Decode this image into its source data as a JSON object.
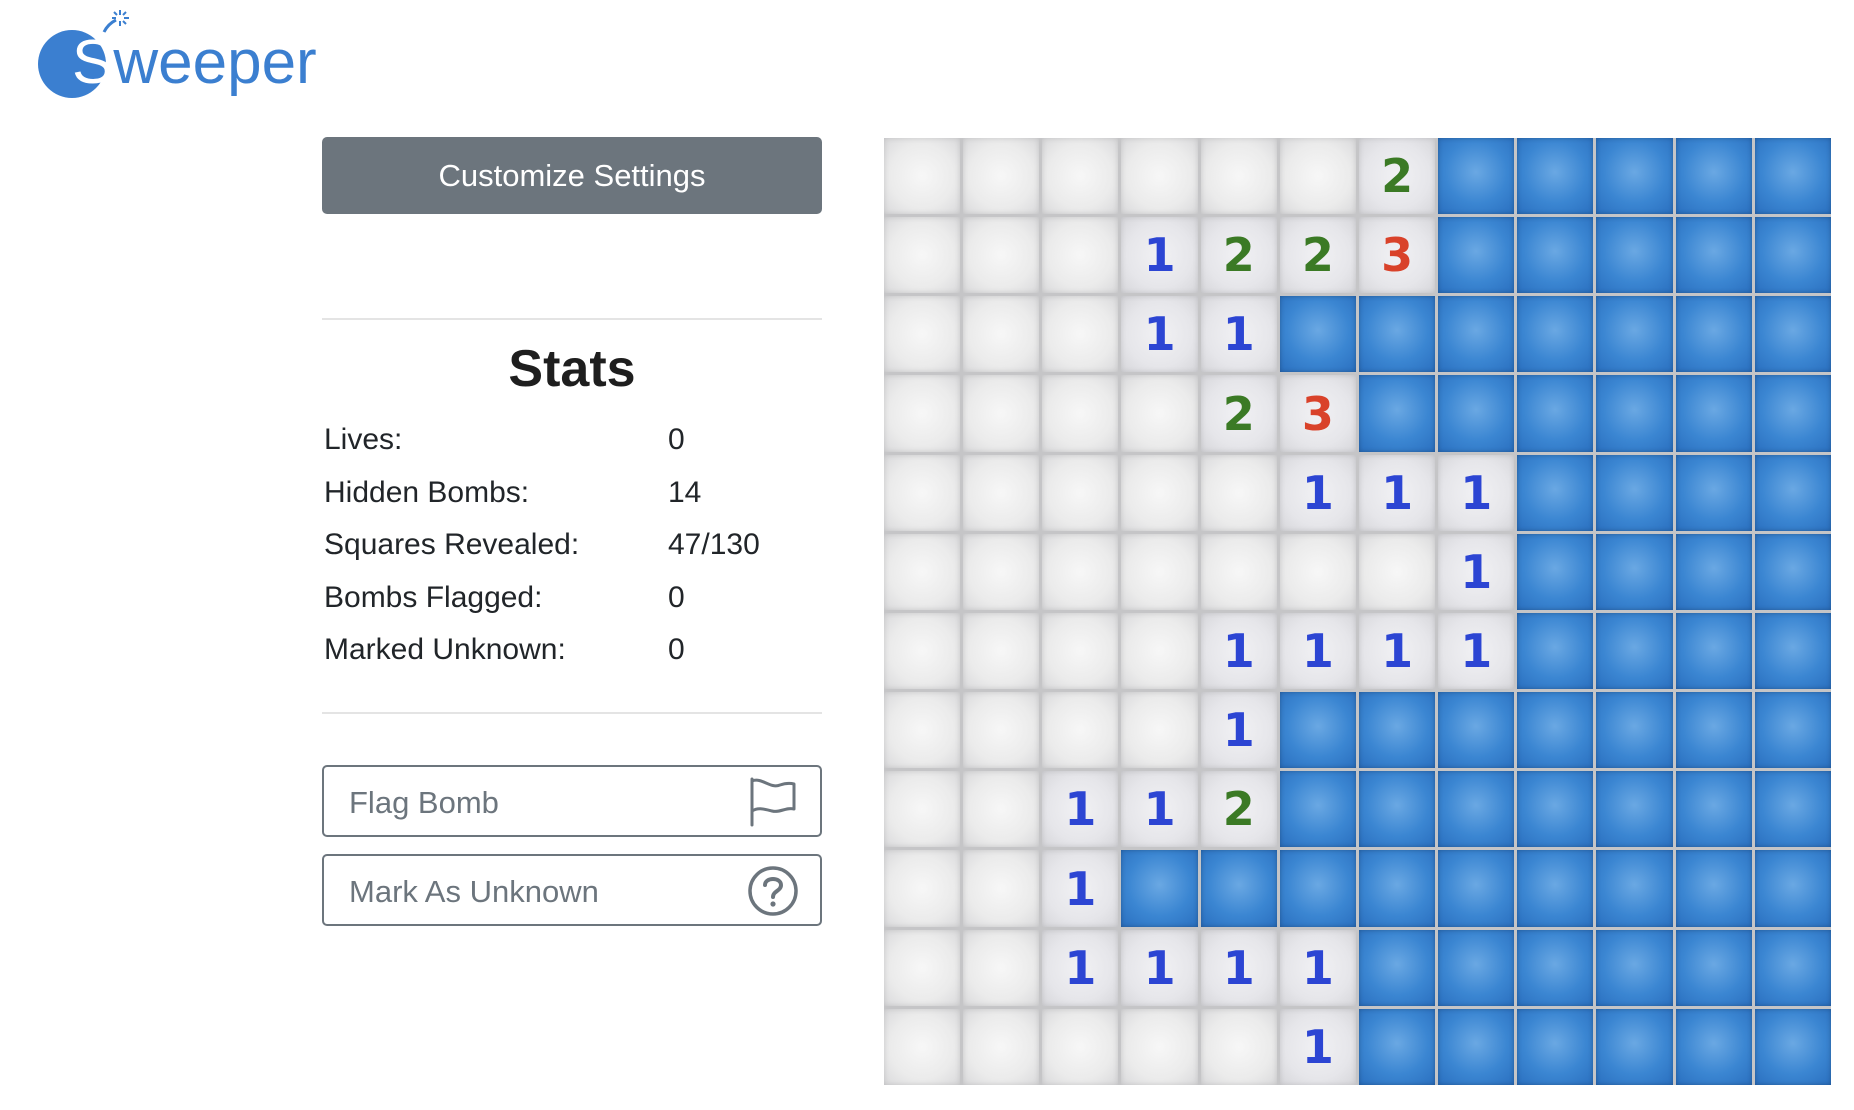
{
  "logo": {
    "text": "Sweeper",
    "accent": "#3b7fd0"
  },
  "controls": {
    "customize_label": "Customize Settings",
    "flag_label": "Flag Bomb",
    "flag_icon": "flag-icon",
    "unknown_label": "Mark As Unknown",
    "unknown_icon": "question-circle-icon"
  },
  "stats": {
    "title": "Stats",
    "rows": [
      {
        "label": "Lives:",
        "value": "0"
      },
      {
        "label": "Hidden Bombs:",
        "value": "14"
      },
      {
        "label": "Squares Revealed:",
        "value": "47/130"
      },
      {
        "label": "Bombs Flagged:",
        "value": "0"
      },
      {
        "label": "Marked Unknown:",
        "value": "0"
      }
    ]
  },
  "board": {
    "rows": 12,
    "cols": 12,
    "colors": {
      "1": "#2c45d3",
      "2": "#3b7a25",
      "3": "#d9422a",
      "hidden": "#3b86d2",
      "revealed": "#ebebeb"
    },
    "grid": [
      [
        "",
        "",
        "",
        "",
        "",
        "",
        "2",
        "H",
        "H",
        "H",
        "H",
        "H"
      ],
      [
        "",
        "",
        "",
        "1",
        "2",
        "2",
        "3",
        "H",
        "H",
        "H",
        "H",
        "H"
      ],
      [
        "",
        "",
        "",
        "1",
        "1",
        "H",
        "H",
        "H",
        "H",
        "H",
        "H",
        "H"
      ],
      [
        "",
        "",
        "",
        "",
        "2",
        "3",
        "H",
        "H",
        "H",
        "H",
        "H",
        "H"
      ],
      [
        "",
        "",
        "",
        "",
        "",
        "1",
        "1",
        "1",
        "H",
        "H",
        "H",
        "H"
      ],
      [
        "",
        "",
        "",
        "",
        "",
        "",
        "",
        "1",
        "H",
        "H",
        "H",
        "H"
      ],
      [
        "",
        "",
        "",
        "",
        "1",
        "1",
        "1",
        "1",
        "H",
        "H",
        "H",
        "H"
      ],
      [
        "",
        "",
        "",
        "",
        "1",
        "H",
        "H",
        "H",
        "H",
        "H",
        "H",
        "H"
      ],
      [
        "",
        "",
        "1",
        "1",
        "2",
        "H",
        "H",
        "H",
        "H",
        "H",
        "H",
        "H"
      ],
      [
        "",
        "",
        "1",
        "H",
        "H",
        "H",
        "H",
        "H",
        "H",
        "H",
        "H",
        "H"
      ],
      [
        "",
        "",
        "1",
        "1",
        "1",
        "1",
        "H",
        "H",
        "H",
        "H",
        "H",
        "H"
      ],
      [
        "",
        "",
        "",
        "",
        "",
        "1",
        "H",
        "H",
        "H",
        "H",
        "H",
        "H"
      ]
    ]
  }
}
